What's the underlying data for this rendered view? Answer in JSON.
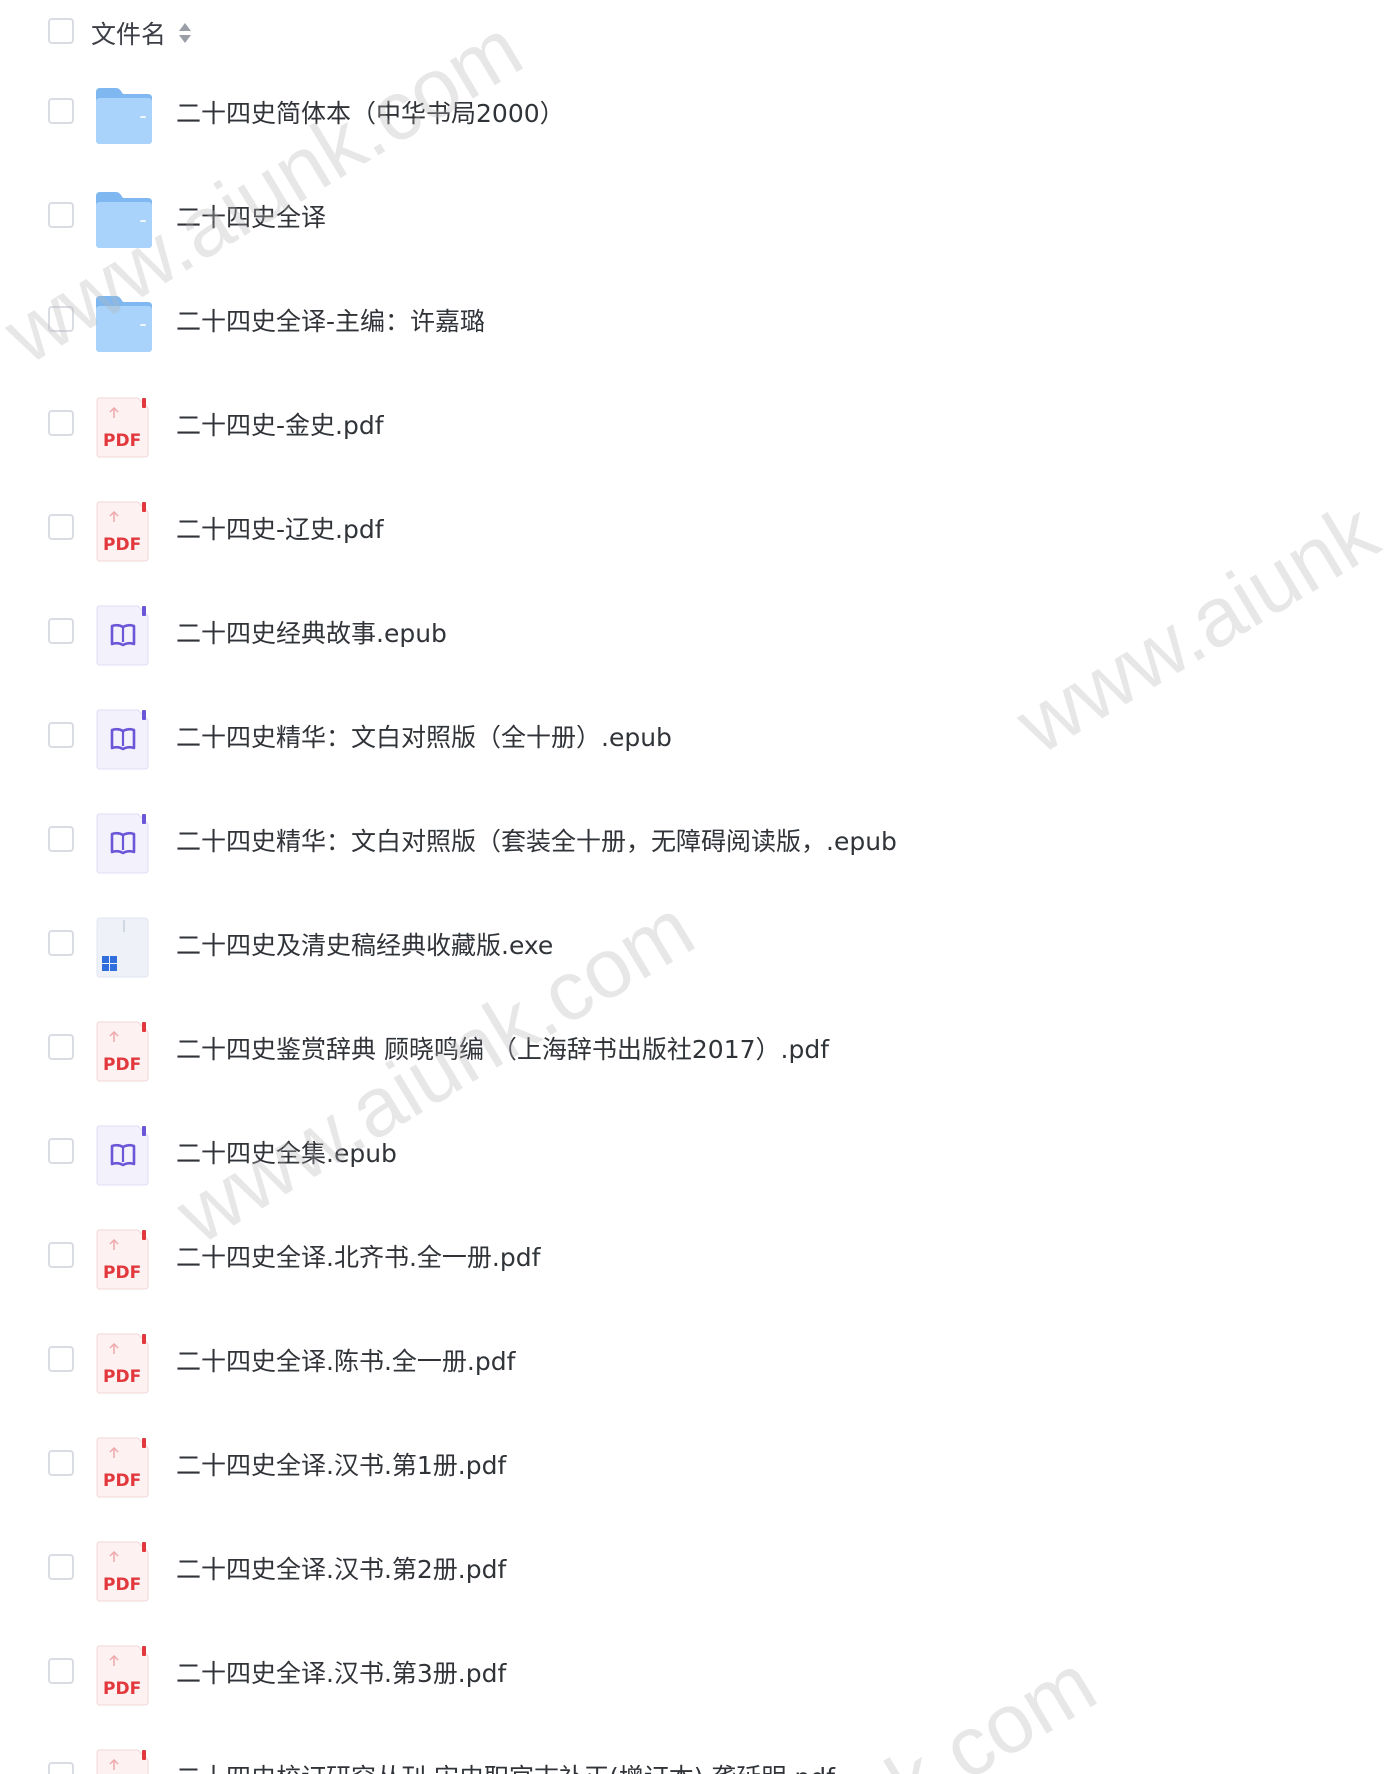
{
  "header": {
    "column_label": "文件名"
  },
  "files": [
    {
      "name": "二十四史简体本（中华书局2000）",
      "type": "folder"
    },
    {
      "name": "二十四史全译",
      "type": "folder"
    },
    {
      "name": "二十四史全译-主编：许嘉璐",
      "type": "folder"
    },
    {
      "name": "二十四史-金史.pdf",
      "type": "pdf"
    },
    {
      "name": "二十四史-辽史.pdf",
      "type": "pdf"
    },
    {
      "name": "二十四史经典故事.epub",
      "type": "epub"
    },
    {
      "name": "二十四史精华：文白对照版（全十册）.epub",
      "type": "epub"
    },
    {
      "name": "二十四史精华：文白对照版（套装全十册，无障碍阅读版，.epub",
      "type": "epub"
    },
    {
      "name": "二十四史及清史稿经典收藏版.exe",
      "type": "exe"
    },
    {
      "name": "二十四史鉴赏辞典 顾晓鸣编 （上海辞书出版社2017）.pdf",
      "type": "pdf"
    },
    {
      "name": "二十四史全集.epub",
      "type": "epub"
    },
    {
      "name": "二十四史全译.北齐书.全一册.pdf",
      "type": "pdf"
    },
    {
      "name": "二十四史全译.陈书.全一册.pdf",
      "type": "pdf"
    },
    {
      "name": "二十四史全译.汉书.第1册.pdf",
      "type": "pdf"
    },
    {
      "name": "二十四史全译.汉书.第2册.pdf",
      "type": "pdf"
    },
    {
      "name": "二十四史全译.汉书.第3册.pdf",
      "type": "pdf"
    },
    {
      "name": "二十四史校订研究丛刊·宋史职官志补正(增订本)·龚延明.pdf",
      "type": "pdf"
    }
  ],
  "icons": {
    "folder": "folder-icon",
    "pdf": "pdf-file-icon",
    "epub": "epub-book-icon",
    "exe": "exe-windows-icon",
    "sort": "sort-arrows-icon"
  },
  "icon_labels": {
    "pdf": "PDF"
  },
  "watermark": {
    "text_a": "www.aiunk.com",
    "text_b": "nk.com"
  },
  "colors": {
    "folder": "#8ec3f4",
    "pdf_red": "#e2383d",
    "epub_purple": "#6b56d8",
    "exe_blue": "#2f6edb",
    "checkbox_border": "#d9dce3",
    "text": "#303338"
  }
}
